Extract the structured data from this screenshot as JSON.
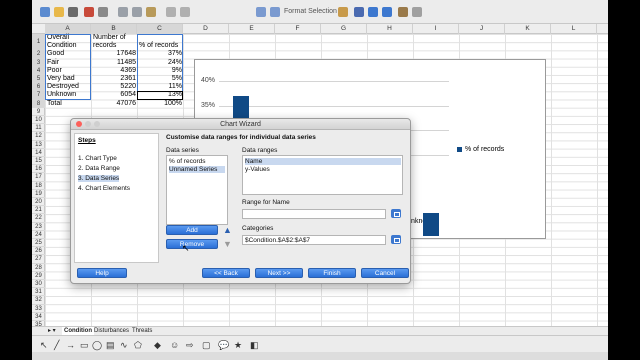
{
  "toolbar": {
    "format_selection_label": "Format Selection"
  },
  "columns": [
    "A",
    "B",
    "C",
    "D",
    "E",
    "F",
    "G",
    "H",
    "I",
    "J",
    "K",
    "L"
  ],
  "rows": [
    "1",
    "2",
    "3",
    "4",
    "5",
    "6",
    "7",
    "8",
    "9",
    "10",
    "11",
    "12",
    "13",
    "14",
    "15",
    "16",
    "17",
    "18",
    "19",
    "20",
    "21",
    "22",
    "23",
    "24",
    "25",
    "26",
    "27",
    "28",
    "29",
    "30",
    "31",
    "32",
    "33",
    "34",
    "35"
  ],
  "table": {
    "header_a": [
      "Overall",
      "Condition"
    ],
    "header_b": [
      "Number of",
      "records"
    ],
    "header_c": "% of records",
    "rows": [
      {
        "condition": "Good",
        "records": "17648",
        "pct": "37%"
      },
      {
        "condition": "Fair",
        "records": "11485",
        "pct": "24%"
      },
      {
        "condition": "Poor",
        "records": "4369",
        "pct": "9%"
      },
      {
        "condition": "Very bad",
        "records": "2361",
        "pct": "5%"
      },
      {
        "condition": "Destroyed",
        "records": "5220",
        "pct": "11%"
      },
      {
        "condition": "Unknown",
        "records": "6054",
        "pct": "13%"
      },
      {
        "condition": "Total",
        "records": "47076",
        "pct": "100%"
      }
    ]
  },
  "chart_data": {
    "type": "bar",
    "categories": [
      "Good",
      "Fair",
      "Poor",
      "Very bad",
      "Destroyed",
      "Unknown"
    ],
    "series": [
      {
        "name": "% of records",
        "values": [
          37,
          24,
          9,
          5,
          11,
          13
        ]
      }
    ],
    "yticks": [
      "40%",
      "35%",
      "30%",
      "25%"
    ],
    "visible_category_label": "Unknown",
    "legend": "% of records",
    "legend_position": "right",
    "accent_color": "#104a86"
  },
  "dialog": {
    "title": "Chart Wizard",
    "steps_heading": "Steps",
    "steps": [
      "1. Chart Type",
      "2. Data Range",
      "3. Data Series",
      "4. Chart Elements"
    ],
    "current_step": 2,
    "heading": "Customise data ranges for individual data series",
    "data_series_label": "Data series",
    "data_series": [
      "% of records",
      "Unnamed Series"
    ],
    "data_ranges_label": "Data ranges",
    "data_ranges": [
      "Name",
      "y-Values"
    ],
    "range_for_name_label": "Range for Name",
    "range_for_name_value": "",
    "categories_label": "Categories",
    "categories_value": "$Condition.$A$2:$A$7",
    "add_label": "Add",
    "remove_label": "Remove",
    "help_label": "Help",
    "back_label": "<< Back",
    "next_label": "Next >>",
    "finish_label": "Finish",
    "cancel_label": "Cancel"
  },
  "sheet_tabs": [
    "Condition",
    "Disturbances",
    "Threats"
  ]
}
